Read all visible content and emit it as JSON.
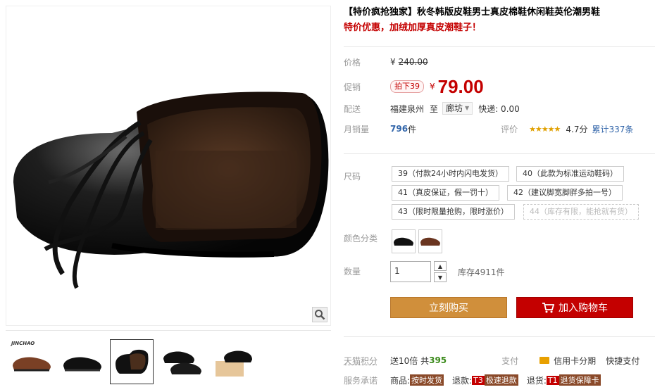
{
  "product": {
    "title": "【特价疯抢独家】秋冬韩版皮鞋男士真皮棉鞋休闲鞋英伦潮男鞋",
    "subtitle": "特价优惠，加绒加厚真皮潮鞋子！"
  },
  "price": {
    "label": "价格",
    "yen": "¥",
    "original": "240.00"
  },
  "promo": {
    "label": "促销",
    "tag": "拍下39",
    "yen": "¥",
    "value": "79.00"
  },
  "shipping": {
    "label": "配送",
    "from": "福建泉州",
    "to_word": "至",
    "destination": "廊坊",
    "fee": "快递: 0.00"
  },
  "sales": {
    "label": "月销量",
    "count": "796",
    "unit": "件",
    "review_label": "评价",
    "stars": "★★★★★",
    "score": "4.7分",
    "total_reviews": "累计337条"
  },
  "size": {
    "label": "尺码",
    "options": [
      "39（付款24小时内闪电发货）",
      "40（此款为标准运动鞋码）",
      "41（真皮保证，假一罚十）",
      "42（建议脚宽脚胖多拍一号）",
      "43（限时限量抢购，限时涨价）",
      "44（库存有限，能抢就有货）"
    ]
  },
  "color": {
    "label": "颜色分类"
  },
  "quantity": {
    "label": "数量",
    "value": "1",
    "up": "▲",
    "down": "▼",
    "stock": "库存4911件"
  },
  "buttons": {
    "buy": "立刻购买",
    "cart": "加入购物车"
  },
  "points": {
    "label": "天猫积分",
    "send": "送10倍 共",
    "amount": "395",
    "pay_label": "支付",
    "credit": "信用卡分期",
    "quick": "快捷支付"
  },
  "service": {
    "label": "服务承诺",
    "goods_prefix": "商品:",
    "goods_badge": "按时发货",
    "refund_prefix": "退款:",
    "refund_t": "T3",
    "refund_badge": "极速退款",
    "return_prefix": "退货:",
    "return_t": "T1",
    "return_badge": "退货保障卡"
  },
  "thumbs": {
    "brand": "JINCHAO"
  },
  "colors": {
    "accent_red": "#c40000",
    "buy_orange": "#d08f3b",
    "link_blue": "#3366aa"
  }
}
